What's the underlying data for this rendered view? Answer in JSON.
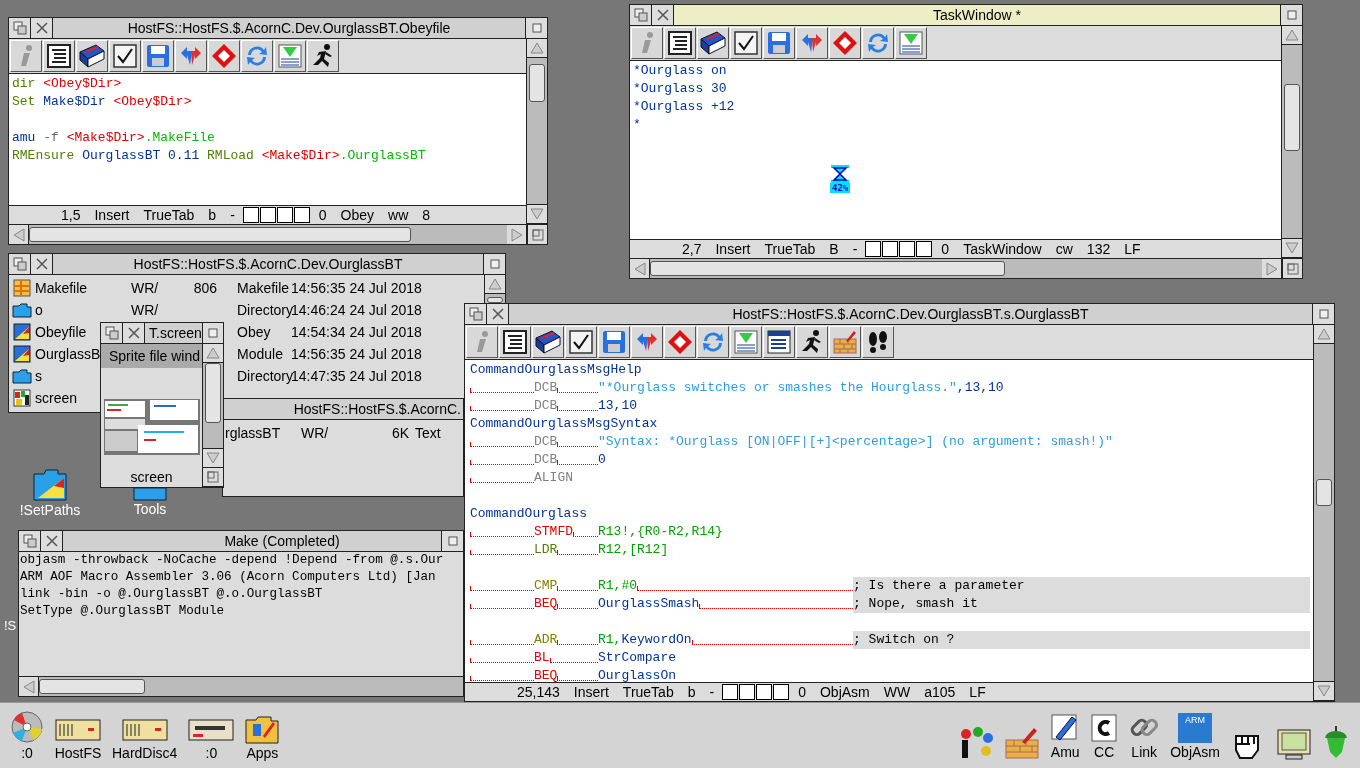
{
  "desktop_icons": [
    {
      "kind": "app",
      "label": "!SetPaths"
    },
    {
      "kind": "folder",
      "label": "Tools"
    },
    {
      "kind": "label_only",
      "label": "!S"
    }
  ],
  "obey_editor": {
    "title": "HostFS::HostFS.$.AcornC.Dev.OurglassBT.Obeyfile",
    "focused": false,
    "toolbar": [
      {
        "kind": "info"
      },
      {
        "kind": "list"
      },
      {
        "kind": "book"
      },
      {
        "kind": "tick"
      },
      {
        "kind": "save"
      },
      {
        "kind": "swap"
      },
      {
        "kind": "diamond"
      },
      {
        "kind": "refresh"
      },
      {
        "kind": "download"
      },
      {
        "kind": "run"
      }
    ],
    "lines": [
      {
        "kind": "code",
        "segments": [
          {
            "text": "dir ",
            "color": "#4f7f00"
          },
          {
            "text": "<Obey$Dir>",
            "color": "#dd0000"
          }
        ]
      },
      {
        "kind": "code",
        "segments": [
          {
            "text": "Set ",
            "color": "#4f7f00"
          },
          {
            "text": "Make$Dir ",
            "color": "#003399"
          },
          {
            "text": "<Obey$Dir>",
            "color": "#dd0000"
          }
        ]
      },
      {
        "kind": "blank"
      },
      {
        "kind": "code",
        "segments": [
          {
            "text": "amu ",
            "color": "#003399"
          },
          {
            "text": "-f ",
            "color": "#666666"
          },
          {
            "text": "<Make$Dir>",
            "color": "#dd0000"
          },
          {
            "text": ".MakeFile",
            "color": "#00bb00"
          }
        ]
      },
      {
        "kind": "code",
        "segments": [
          {
            "text": "RMEnsure ",
            "color": "#4f7f00"
          },
          {
            "text": "OurglassBT 0.11 ",
            "color": "#003399"
          },
          {
            "text": "RMLoad ",
            "color": "#4f7f00"
          },
          {
            "text": "<Make$Dir>",
            "color": "#dd0000"
          },
          {
            "text": ".OurglassBT",
            "color": "#00bb00"
          }
        ]
      }
    ],
    "status": [
      {
        "kind": "text",
        "text": "1,5"
      },
      {
        "kind": "text",
        "text": "Insert"
      },
      {
        "kind": "text",
        "text": "TrueTab"
      },
      {
        "kind": "text",
        "text": "b"
      },
      {
        "kind": "text",
        "text": "-"
      },
      {
        "kind": "boxes"
      },
      {
        "kind": "text",
        "text": "0"
      },
      {
        "kind": "text",
        "text": "Obey"
      },
      {
        "kind": "text",
        "text": "ww"
      },
      {
        "kind": "text",
        "text": "8"
      }
    ]
  },
  "task_window": {
    "title": "TaskWindow *",
    "focused": true,
    "toolbar": [
      {
        "kind": "info"
      },
      {
        "kind": "list"
      },
      {
        "kind": "book"
      },
      {
        "kind": "tick"
      },
      {
        "kind": "save"
      },
      {
        "kind": "swap"
      },
      {
        "kind": "diamond"
      },
      {
        "kind": "refresh"
      },
      {
        "kind": "download"
      }
    ],
    "lines": [
      "*Ourglass on",
      "*Ourglass 30",
      "*Ourglass +12",
      "*"
    ],
    "hourglass": {
      "label": "42%"
    },
    "status": [
      {
        "kind": "text",
        "text": "2,7"
      },
      {
        "kind": "text",
        "text": "Insert"
      },
      {
        "kind": "text",
        "text": "TrueTab"
      },
      {
        "kind": "text",
        "text": "B"
      },
      {
        "kind": "text",
        "text": "-"
      },
      {
        "kind": "boxes"
      },
      {
        "kind": "text",
        "text": "0"
      },
      {
        "kind": "text",
        "text": "TaskWindow"
      },
      {
        "kind": "text",
        "text": "cw"
      },
      {
        "kind": "text",
        "text": "132"
      },
      {
        "kind": "text",
        "text": "LF"
      }
    ]
  },
  "filer": {
    "title": "HostFS::HostFS.$.AcornC.Dev.OurglassBT",
    "focused": false,
    "rows": [
      {
        "kind": "makefile",
        "name": "Makefile",
        "access": "WR/",
        "size": "806",
        "type": "Makefile",
        "date": "14:56:35 24 Jul 2018"
      },
      {
        "kind": "folder",
        "name": "o",
        "access": "WR/",
        "type": "Directory",
        "date": "14:46:24 24 Jul 2018"
      },
      {
        "kind": "obey",
        "name": "Obeyfile",
        "type": "Obey",
        "date": "14:54:34 24 Jul 2018"
      },
      {
        "kind": "module",
        "name": "OurglassB",
        "type": "Module",
        "date": "14:56:35 24 Jul 2018"
      },
      {
        "kind": "folder",
        "name": "s",
        "type": "Directory",
        "date": "14:47:35 24 Jul 2018"
      },
      {
        "kind": "sprite",
        "name": "screen"
      }
    ]
  },
  "filer_s": {
    "title": "HostFS::HostFS.$.AcornC.",
    "focused": false,
    "rows": [
      {
        "name": "rglassBT",
        "access": "WR/",
        "size": "6K",
        "type": "Text"
      }
    ]
  },
  "sprite_window": {
    "title": "T.screen",
    "focused": false,
    "header": "Sprite file wind",
    "sprite_name": "screen"
  },
  "make_output": {
    "title": "Make (Completed)",
    "focused": false,
    "lines": [
      "objasm -throwback -NoCache -depend !Depend -from @.s.Our",
      "ARM AOF Macro Assembler 3.06 (Acorn Computers Ltd) [Jan",
      "link -bin -o @.OurglassBT @.o.OurglassBT",
      "SetType @.OurglassBT Module"
    ]
  },
  "source_editor": {
    "title": "HostFS::HostFS.$.AcornC.Dev.OurglassBT.s.OurglassBT",
    "focused": false,
    "toolbar": [
      {
        "kind": "info"
      },
      {
        "kind": "list"
      },
      {
        "kind": "book"
      },
      {
        "kind": "tick"
      },
      {
        "kind": "save"
      },
      {
        "kind": "swap"
      },
      {
        "kind": "diamond"
      },
      {
        "kind": "refresh"
      },
      {
        "kind": "download"
      },
      {
        "kind": "panel"
      },
      {
        "kind": "run"
      },
      {
        "kind": "brick"
      },
      {
        "kind": "footprints"
      }
    ],
    "lines": [
      {
        "kind": "label",
        "text": "CommandOurglassMsgHelp",
        "color": "#003399"
      },
      {
        "kind": "instruction",
        "op": {
          "text": "DCB",
          "color": "#808080"
        },
        "args": [
          {
            "text": "\"*Ourglass switches or smashes the Hourglass.\"",
            "color": "#2a9fe0"
          },
          {
            "text": ",13,10",
            "color": "#003399"
          }
        ]
      },
      {
        "kind": "instruction",
        "op": {
          "text": "DCB",
          "color": "#808080"
        },
        "args": [
          {
            "text": "13,10",
            "color": "#003399"
          }
        ]
      },
      {
        "kind": "label",
        "text": "CommandOurglassMsgSyntax",
        "color": "#003399"
      },
      {
        "kind": "instruction",
        "op": {
          "text": "DCB",
          "color": "#808080"
        },
        "args": [
          {
            "text": "\"Syntax: *Ourglass [ON|OFF|[+]<percentage>] (no argument: smash!)\"",
            "color": "#2a9fe0"
          }
        ]
      },
      {
        "kind": "instruction",
        "op": {
          "text": "DCB",
          "color": "#808080"
        },
        "args": [
          {
            "text": "0",
            "color": "#003399"
          }
        ]
      },
      {
        "kind": "instruction",
        "op": {
          "text": "ALIGN",
          "color": "#808080"
        }
      },
      {
        "kind": "blank"
      },
      {
        "kind": "label",
        "text": "CommandOurglass",
        "color": "#003399"
      },
      {
        "kind": "instruction",
        "op": {
          "text": "STMFD",
          "color": "#dd0000"
        },
        "args": [
          {
            "text": "R13!,{R0-R2,R14}",
            "color": "#00a000"
          }
        ]
      },
      {
        "kind": "instruction",
        "op": {
          "text": "LDR",
          "color": "#4f7f00"
        },
        "args": [
          {
            "text": "R12,[R12]",
            "color": "#00a000"
          }
        ]
      },
      {
        "kind": "blank"
      },
      {
        "kind": "instruction",
        "op": {
          "text": "CMP",
          "color": "#7f7f00"
        },
        "args": [
          {
            "text": "R1,#0",
            "color": "#00a000"
          }
        ],
        "comment": "; Is there a parameter"
      },
      {
        "kind": "instruction",
        "op": {
          "text": "BEQ",
          "color": "#dd0000"
        },
        "args": [
          {
            "text": "OurglassSmash",
            "color": "#003399"
          }
        ],
        "comment": "; Nope, smash it"
      },
      {
        "kind": "blank"
      },
      {
        "kind": "instruction",
        "op": {
          "text": "ADR",
          "color": "#7f7f00"
        },
        "args": [
          {
            "text": "R1,",
            "color": "#00a000"
          },
          {
            "text": "KeywordOn",
            "color": "#003399"
          }
        ],
        "comment": "; Switch on ?"
      },
      {
        "kind": "instruction",
        "op": {
          "text": "BL",
          "color": "#dd0000"
        },
        "args": [
          {
            "text": "StrCompare",
            "color": "#003399"
          }
        ]
      },
      {
        "kind": "instruction",
        "op": {
          "text": "BEQ",
          "color": "#dd0000"
        },
        "args": [
          {
            "text": "OurglassOn",
            "color": "#003399"
          }
        ]
      }
    ],
    "status": [
      {
        "kind": "text",
        "text": "25,143"
      },
      {
        "kind": "text",
        "text": "Insert"
      },
      {
        "kind": "text",
        "text": "TrueTab"
      },
      {
        "kind": "text",
        "text": "b"
      },
      {
        "kind": "text",
        "text": "-"
      },
      {
        "kind": "boxes"
      },
      {
        "kind": "text",
        "text": "0"
      },
      {
        "kind": "text",
        "text": "ObjAsm"
      },
      {
        "kind": "text",
        "text": "WW"
      },
      {
        "kind": "text",
        "text": "a105"
      },
      {
        "kind": "text",
        "text": "LF"
      }
    ]
  },
  "icon_bar": {
    "left": [
      {
        "kind": "cd",
        "label": ":0"
      },
      {
        "kind": "drive",
        "label": "HostFS"
      },
      {
        "kind": "drive",
        "label": "HardDisc4"
      },
      {
        "kind": "floppy",
        "label": ":0"
      },
      {
        "kind": "apps",
        "label": "Apps"
      }
    ],
    "right": [
      {
        "kind": "palette"
      },
      {
        "kind": "brick"
      },
      {
        "kind": "pen",
        "label": "Amu"
      },
      {
        "kind": "paper",
        "label": "CC"
      },
      {
        "kind": "chain",
        "label": "Link"
      },
      {
        "kind": "chip",
        "badge": "ARM",
        "label": "ObjAsm"
      },
      {
        "kind": "fist"
      },
      {
        "kind": "monitor"
      },
      {
        "kind": "acorn"
      }
    ]
  }
}
